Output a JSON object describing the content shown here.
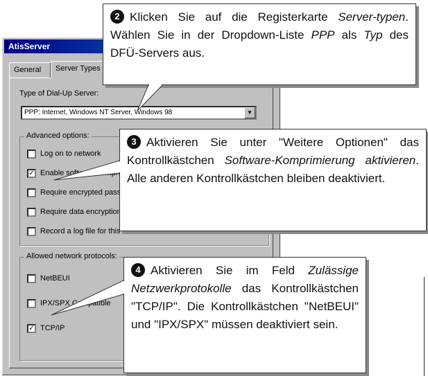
{
  "dialog": {
    "title": "AtisServer",
    "tabs": [
      {
        "label": "General"
      },
      {
        "label": "Server Types"
      }
    ],
    "dialup_type_label": "Type of Dial-Up Server:",
    "dialup_type_value": "PPP: Internet, Windows NT Server, Windows 98",
    "advanced_options": {
      "title": "Advanced options:",
      "items": [
        {
          "label": "Log on to network",
          "checked": false
        },
        {
          "label": "Enable software compression",
          "checked": true
        },
        {
          "label": "Require encrypted password",
          "checked": false
        },
        {
          "label": "Require data encryption",
          "checked": false
        },
        {
          "label": "Record a log file for this connection",
          "checked": false
        }
      ]
    },
    "network_protocols": {
      "title": "Allowed network protocols:",
      "items": [
        {
          "label": "NetBEUI",
          "checked": false
        },
        {
          "label": "IPX/SPX Compatible",
          "checked": false
        },
        {
          "label": "TCP/IP",
          "checked": true
        }
      ]
    }
  },
  "callouts": {
    "step2": {
      "badge": "2",
      "p1": "Klicken Sie auf die Registerkarte ",
      "em1": "Server-typen",
      "p2": ". Wählen Sie in der Dropdown-Liste ",
      "em2": "PPP",
      "p3": " als ",
      "em3": "Typ",
      "p4": " des DFÜ-Servers aus."
    },
    "step3": {
      "badge": "3",
      "p1": "Aktivieren Sie unter \"Weitere Optionen\" das Kontrollkästchen ",
      "em1": "Software-Komprimierung aktivieren",
      "p2": ". Alle anderen Kontrollkästchen bleiben deaktiviert."
    },
    "step4": {
      "badge": "4",
      "p1": "Aktivieren Sie im Feld ",
      "em1": "Zulässige Netzwerkprotokolle",
      "p2": " das Kontrollkästchen \"TCP/IP\". Die Kontrollkästchen \"NetBEUI\" und \"IPX/SPX\" müssen deaktiviert sein."
    }
  },
  "icons": {
    "combo_arrow": "chevron-down-icon",
    "check_mark": "check-icon"
  },
  "colors": {
    "titlebar_start": "#000080",
    "titlebar_end": "#1084d0",
    "dialog_bg": "#c0c0c0"
  }
}
